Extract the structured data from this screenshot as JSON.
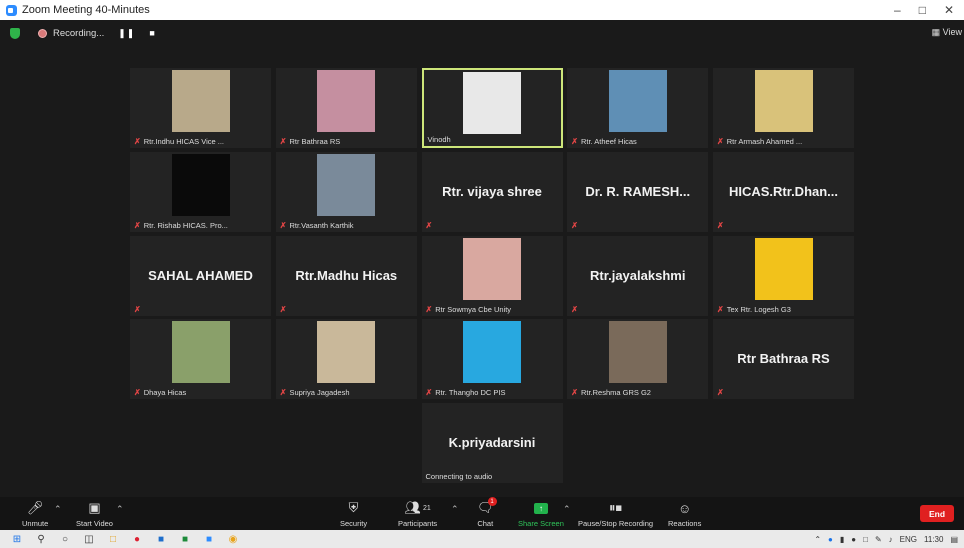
{
  "window": {
    "title": "Zoom Meeting 40-Minutes"
  },
  "recording": {
    "status": "Recording...",
    "pause_icon": "pause-icon",
    "stop_icon": "stop-icon"
  },
  "view": {
    "label": "View"
  },
  "participants": [
    {
      "label": "Rtr.Indhu HICAS Vice ...",
      "muted": true,
      "kind": "video",
      "color": "#b8a98a"
    },
    {
      "label": "Rtr Bathraa RS",
      "muted": true,
      "kind": "video",
      "color": "#c58fa0"
    },
    {
      "label": "Vinodh",
      "muted": false,
      "kind": "video",
      "active": true,
      "color": "#e8e8e8"
    },
    {
      "label": "Rtr. Atheef Hicas",
      "muted": true,
      "kind": "video",
      "color": "#5f8fb5"
    },
    {
      "label": "Rtr Armash Ahamed ...",
      "muted": true,
      "kind": "video",
      "color": "#d9c27a"
    },
    {
      "label": "Rtr. Rishab HICAS. Pro...",
      "muted": true,
      "kind": "video",
      "color": "#0a0a0a"
    },
    {
      "label": "Rtr.Vasanth Karthik",
      "muted": true,
      "kind": "video",
      "color": "#7a8a9a"
    },
    {
      "label": "",
      "muted": true,
      "kind": "name",
      "name": "Rtr. vijaya shree"
    },
    {
      "label": "",
      "muted": true,
      "kind": "name",
      "name": "Dr. R. RAMESH..."
    },
    {
      "label": "",
      "muted": true,
      "kind": "name",
      "name": "HICAS.Rtr.Dhan..."
    },
    {
      "label": "",
      "muted": true,
      "kind": "name",
      "name": "SAHAL AHAMED"
    },
    {
      "label": "",
      "muted": true,
      "kind": "name",
      "name": "Rtr.Madhu Hicas"
    },
    {
      "label": "Rtr Sowmya Cbe Unity",
      "muted": true,
      "kind": "video",
      "color": "#d9a8a0"
    },
    {
      "label": "",
      "muted": true,
      "kind": "name",
      "name": "Rtr.jayalakshmi"
    },
    {
      "label": "Tex Rtr. Logesh G3",
      "muted": true,
      "kind": "video",
      "color": "#f2c21b"
    },
    {
      "label": "Dhaya Hicas",
      "muted": true,
      "kind": "video",
      "color": "#8aa06a"
    },
    {
      "label": "Supriya Jagadesh",
      "muted": true,
      "kind": "video",
      "color": "#c9b89a"
    },
    {
      "label": "Rtr. Thangho DC PIS",
      "muted": true,
      "kind": "video",
      "color": "#28a8e0"
    },
    {
      "label": "Rtr.Reshma GRS G2",
      "muted": true,
      "kind": "video",
      "color": "#7a6a5a"
    },
    {
      "label": "",
      "muted": true,
      "kind": "name",
      "name": "Rtr Bathraa RS"
    },
    {
      "label": "Connecting to audio",
      "muted": false,
      "kind": "name",
      "name": "K.priyadarsini"
    }
  ],
  "toolbar": {
    "unmute": "Unmute",
    "start_video": "Start Video",
    "security": "Security",
    "participants": "Participants",
    "participants_count": "21",
    "chat": "Chat",
    "chat_badge": "1",
    "share_screen": "Share Screen",
    "pause_stop_recording": "Pause/Stop Recording",
    "reactions": "Reactions",
    "end": "End"
  },
  "taskbar": {
    "language": "ENG",
    "time": "11:30"
  }
}
